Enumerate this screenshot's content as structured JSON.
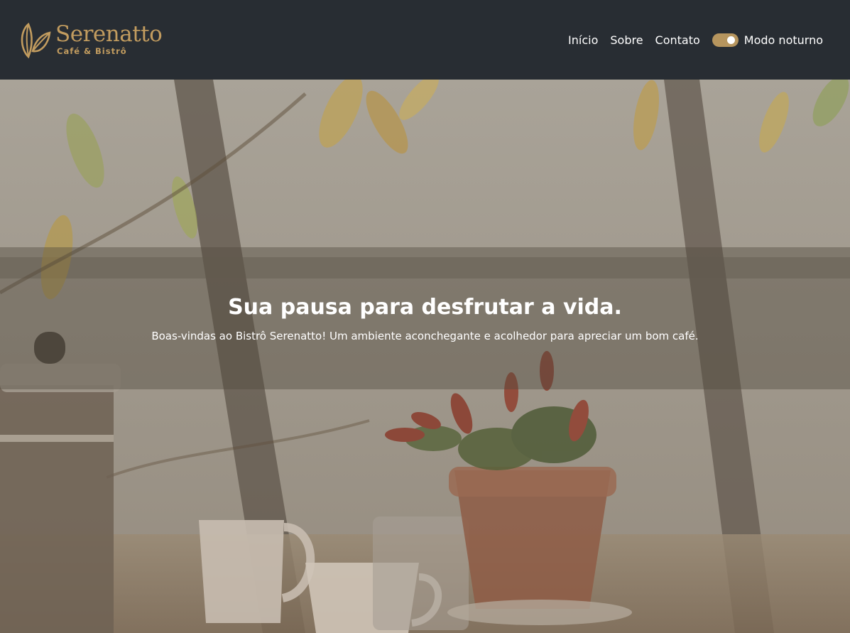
{
  "header": {
    "brand_name": "Serenatto",
    "brand_tagline": "Café & Bistrô",
    "nav": [
      {
        "label": "Início"
      },
      {
        "label": "Sobre"
      },
      {
        "label": "Contato"
      }
    ],
    "night_mode": {
      "label": "Modo noturno",
      "enabled": true
    }
  },
  "hero": {
    "title": "Sua pausa para desfrutar a vida.",
    "subtitle": "Boas-vindas ao Bistrô Serenatto! Um ambiente aconchegante e acolhedor para apreciar um bom café."
  },
  "colors": {
    "header_bg": "#282d33",
    "accent": "#c29c5f",
    "toggle": "#b6955e",
    "text_light": "#ffffff"
  },
  "icons": {
    "logo": "coffee-bean-leaf-icon"
  }
}
